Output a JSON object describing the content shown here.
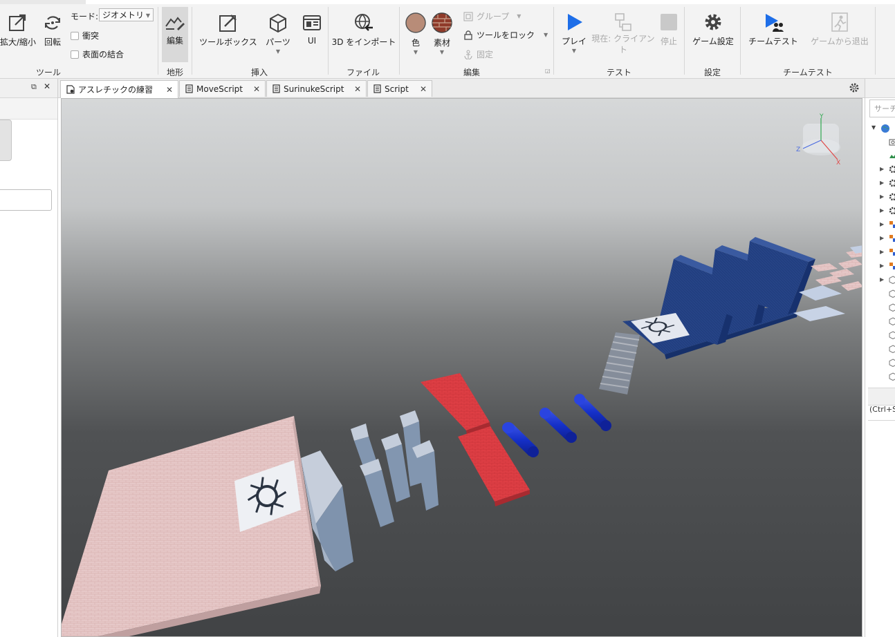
{
  "ribbon": {
    "tools_group": {
      "label": "ツール",
      "scale": "拡大/縮小",
      "rotate": "回転",
      "mode_label": "モード:",
      "mode_value": "ジオメトリ",
      "collide": "衝突",
      "join_surfaces": "表面の結合"
    },
    "terrain_group": {
      "label": "地形",
      "edit": "編集"
    },
    "insert_group": {
      "label": "挿入",
      "toolbox": "ツールボックス",
      "parts": "パーツ",
      "ui": "UI"
    },
    "file_group": {
      "label": "ファイル",
      "import3d": "3D をインポート"
    },
    "edit_group": {
      "label": "編集",
      "color": "色",
      "material": "素材",
      "group": "グループ",
      "lock_tool": "ツールをロック",
      "anchor": "固定"
    },
    "test_group": {
      "label": "テスト",
      "play": "プレイ",
      "current_client": "現在: クライアント",
      "stop": "停止"
    },
    "settings_group": {
      "label": "設定",
      "game_settings": "ゲーム設定"
    },
    "team_test_group": {
      "label": "チームテスト",
      "team_test": "チームテスト",
      "exit_game": "ゲームから退出"
    }
  },
  "tabs": [
    {
      "label": "アスレチックの練習",
      "active": true
    },
    {
      "label": "MoveScript",
      "active": false
    },
    {
      "label": "SurinukeScript",
      "active": false
    },
    {
      "label": "Script",
      "active": false
    }
  ],
  "tab_close_glyph": "✕",
  "viewport": {
    "axis_labels": {
      "x": "X",
      "y": "Y",
      "z": "Z"
    }
  },
  "right_panel": {
    "search_placeholder": "サーチ",
    "shortcut_hint": "(Ctrl+S"
  },
  "colors": {
    "play_blue": "#1e6ee8",
    "part_red": "#d63a40",
    "part_navy": "#1f3f85",
    "cylinder_blue": "#1530c8"
  }
}
